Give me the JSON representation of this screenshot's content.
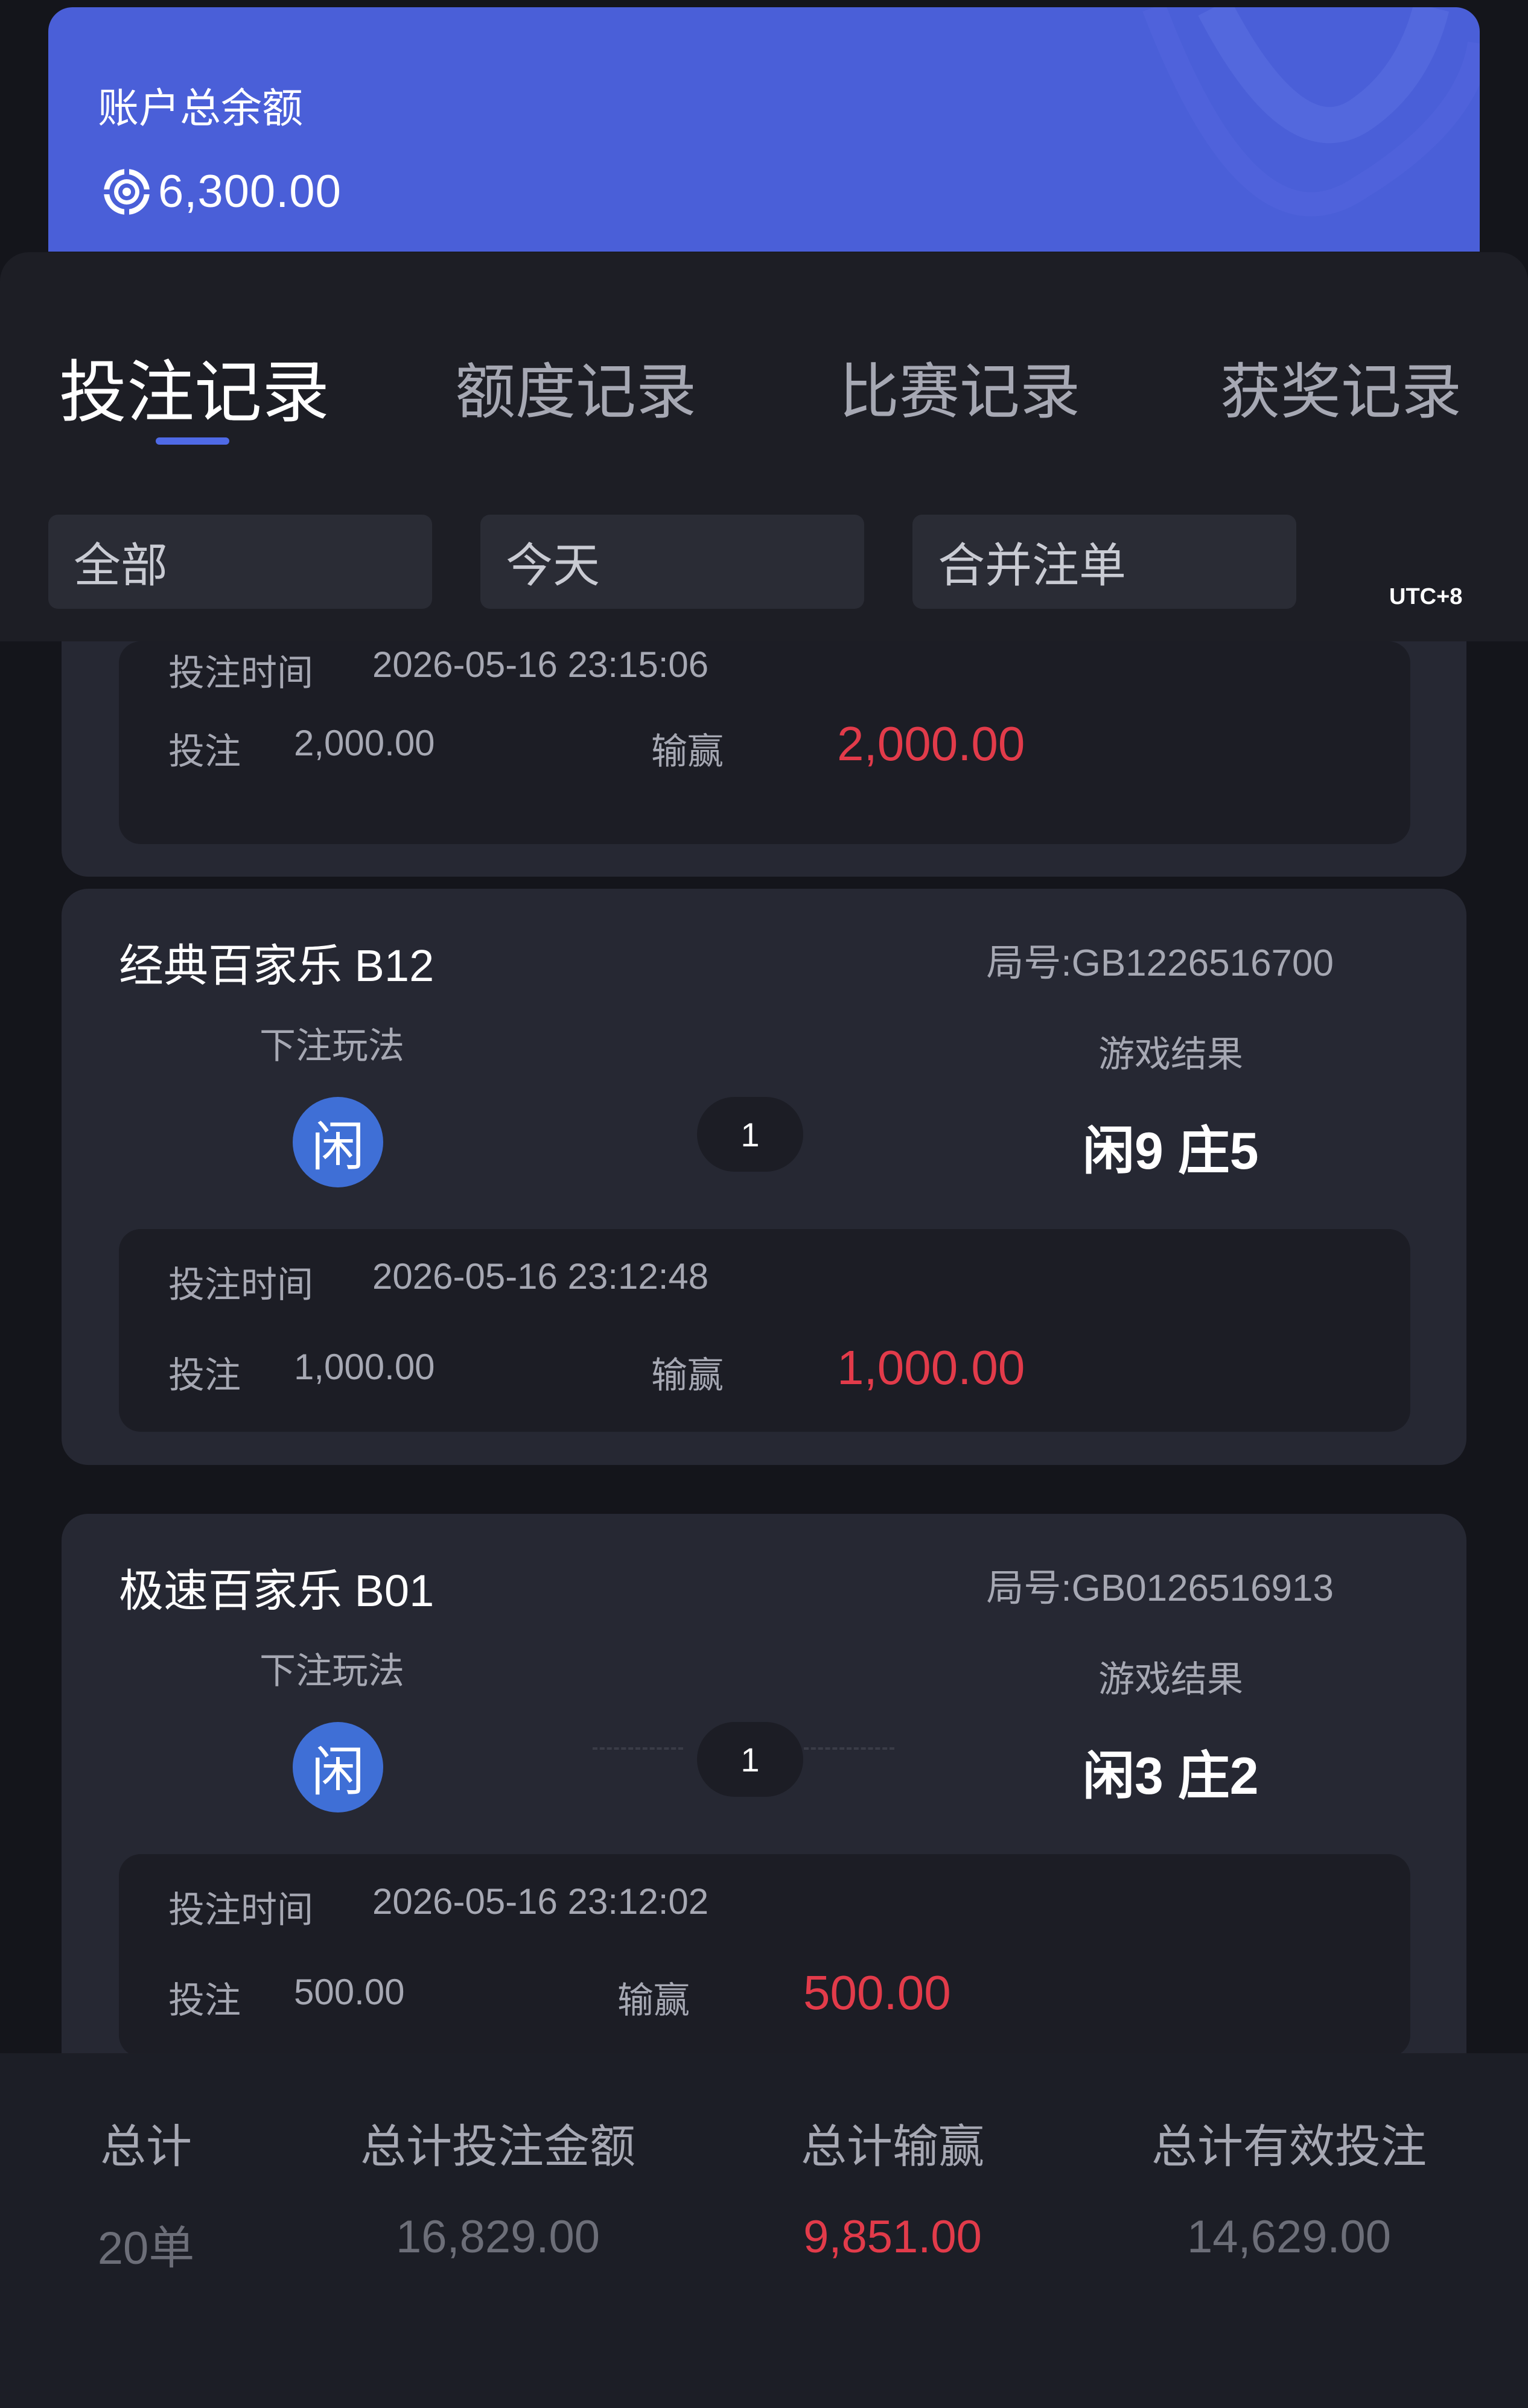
{
  "balance": {
    "label": "账户总余额",
    "amount": "6,300.00",
    "icon": "casino-chip-icon"
  },
  "tabs": [
    {
      "label": "投注记录",
      "active": true
    },
    {
      "label": "额度记录",
      "active": false
    },
    {
      "label": "比赛记录",
      "active": false
    },
    {
      "label": "获奖记录",
      "active": false
    }
  ],
  "filters": [
    {
      "label": "全部"
    },
    {
      "label": "今天"
    },
    {
      "label": "合并注单"
    }
  ],
  "timezone": "UTC+8",
  "records": [
    {
      "partial": true,
      "bet_time_label": "投注时间",
      "bet_time": "2026-05-16 23:15:06",
      "stake_label": "投注",
      "stake": "2,000.00",
      "winloss_label": "输赢",
      "winloss": "2,000.00"
    },
    {
      "game": "经典百家乐 B12",
      "round": "局号:GB1226516700",
      "bet_type_label": "下注玩法",
      "bet_type": "闲",
      "count": "1",
      "result_label": "游戏结果",
      "result": "闲9 庄5",
      "bet_time_label": "投注时间",
      "bet_time": "2026-05-16 23:12:48",
      "stake_label": "投注",
      "stake": "1,000.00",
      "winloss_label": "输赢",
      "winloss": "1,000.00"
    },
    {
      "game": "极速百家乐 B01",
      "round": "局号:GB0126516913",
      "bet_type_label": "下注玩法",
      "bet_type": "闲",
      "count": "1",
      "result_label": "游戏结果",
      "result": "闲3 庄2",
      "bet_time_label": "投注时间",
      "bet_time": "2026-05-16 23:12:02",
      "stake_label": "投注",
      "stake": "500.00",
      "winloss_label": "输赢",
      "winloss": "500.00"
    }
  ],
  "summary": [
    {
      "label": "总计",
      "value": "20单"
    },
    {
      "label": "总计投注金额",
      "value": "16,829.00"
    },
    {
      "label": "总计输赢",
      "value": "9,851.00",
      "highlight": true
    },
    {
      "label": "总计有效投注",
      "value": "14,629.00"
    }
  ],
  "colors": {
    "accent": "#4a5fd8",
    "tab_indicator": "#4f6ae6",
    "win_red": "#e23b4a",
    "badge_blue": "#3f6fd6"
  }
}
